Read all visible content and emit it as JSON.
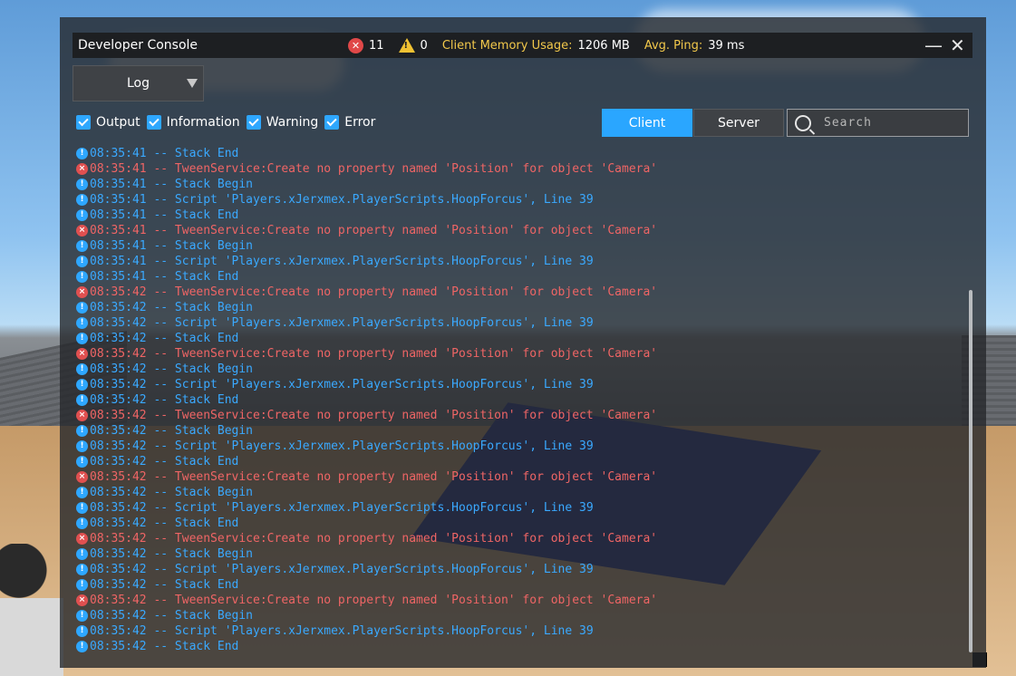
{
  "window": {
    "title": "Developer Console",
    "error_count": "11",
    "warning_count": "0",
    "memory_label": "Client Memory Usage:",
    "memory_value": "1206 MB",
    "ping_label": "Avg. Ping:",
    "ping_value": "39 ms",
    "minimize": "—",
    "close": "✕"
  },
  "view_dropdown": {
    "selected": "Log"
  },
  "filters": [
    {
      "label": "Output",
      "checked": true
    },
    {
      "label": "Information",
      "checked": true
    },
    {
      "label": "Warning",
      "checked": true
    },
    {
      "label": "Error",
      "checked": true
    }
  ],
  "tabs": {
    "client": "Client",
    "server": "Server",
    "active": "Client"
  },
  "search": {
    "placeholder": "Search",
    "value": ""
  },
  "colors": {
    "accent": "#2aa6ff",
    "info": "#3aa9ff",
    "error": "#ef6565",
    "warning_label": "#f2c84b"
  },
  "log": [
    {
      "type": "info",
      "text": "08:35:41 -- Stack End"
    },
    {
      "type": "error",
      "text": "08:35:41 -- TweenService:Create no property named 'Position' for object 'Camera'"
    },
    {
      "type": "info",
      "text": "08:35:41 -- Stack Begin"
    },
    {
      "type": "info",
      "text": "08:35:41 -- Script 'Players.xJerxmex.PlayerScripts.HoopForcus', Line 39"
    },
    {
      "type": "info",
      "text": "08:35:41 -- Stack End"
    },
    {
      "type": "error",
      "text": "08:35:41 -- TweenService:Create no property named 'Position' for object 'Camera'"
    },
    {
      "type": "info",
      "text": "08:35:41 -- Stack Begin"
    },
    {
      "type": "info",
      "text": "08:35:41 -- Script 'Players.xJerxmex.PlayerScripts.HoopForcus', Line 39"
    },
    {
      "type": "info",
      "text": "08:35:41 -- Stack End"
    },
    {
      "type": "error",
      "text": "08:35:42 -- TweenService:Create no property named 'Position' for object 'Camera'"
    },
    {
      "type": "info",
      "text": "08:35:42 -- Stack Begin"
    },
    {
      "type": "info",
      "text": "08:35:42 -- Script 'Players.xJerxmex.PlayerScripts.HoopForcus', Line 39"
    },
    {
      "type": "info",
      "text": "08:35:42 -- Stack End"
    },
    {
      "type": "error",
      "text": "08:35:42 -- TweenService:Create no property named 'Position' for object 'Camera'"
    },
    {
      "type": "info",
      "text": "08:35:42 -- Stack Begin"
    },
    {
      "type": "info",
      "text": "08:35:42 -- Script 'Players.xJerxmex.PlayerScripts.HoopForcus', Line 39"
    },
    {
      "type": "info",
      "text": "08:35:42 -- Stack End"
    },
    {
      "type": "error",
      "text": "08:35:42 -- TweenService:Create no property named 'Position' for object 'Camera'"
    },
    {
      "type": "info",
      "text": "08:35:42 -- Stack Begin"
    },
    {
      "type": "info",
      "text": "08:35:42 -- Script 'Players.xJerxmex.PlayerScripts.HoopForcus', Line 39"
    },
    {
      "type": "info",
      "text": "08:35:42 -- Stack End"
    },
    {
      "type": "error",
      "text": "08:35:42 -- TweenService:Create no property named 'Position' for object 'Camera'"
    },
    {
      "type": "info",
      "text": "08:35:42 -- Stack Begin"
    },
    {
      "type": "info",
      "text": "08:35:42 -- Script 'Players.xJerxmex.PlayerScripts.HoopForcus', Line 39"
    },
    {
      "type": "info",
      "text": "08:35:42 -- Stack End"
    },
    {
      "type": "error",
      "text": "08:35:42 -- TweenService:Create no property named 'Position' for object 'Camera'"
    },
    {
      "type": "info",
      "text": "08:35:42 -- Stack Begin"
    },
    {
      "type": "info",
      "text": "08:35:42 -- Script 'Players.xJerxmex.PlayerScripts.HoopForcus', Line 39"
    },
    {
      "type": "info",
      "text": "08:35:42 -- Stack End"
    },
    {
      "type": "error",
      "text": "08:35:42 -- TweenService:Create no property named 'Position' for object 'Camera'"
    },
    {
      "type": "info",
      "text": "08:35:42 -- Stack Begin"
    },
    {
      "type": "info",
      "text": "08:35:42 -- Script 'Players.xJerxmex.PlayerScripts.HoopForcus', Line 39"
    },
    {
      "type": "info",
      "text": "08:35:42 -- Stack End"
    }
  ]
}
